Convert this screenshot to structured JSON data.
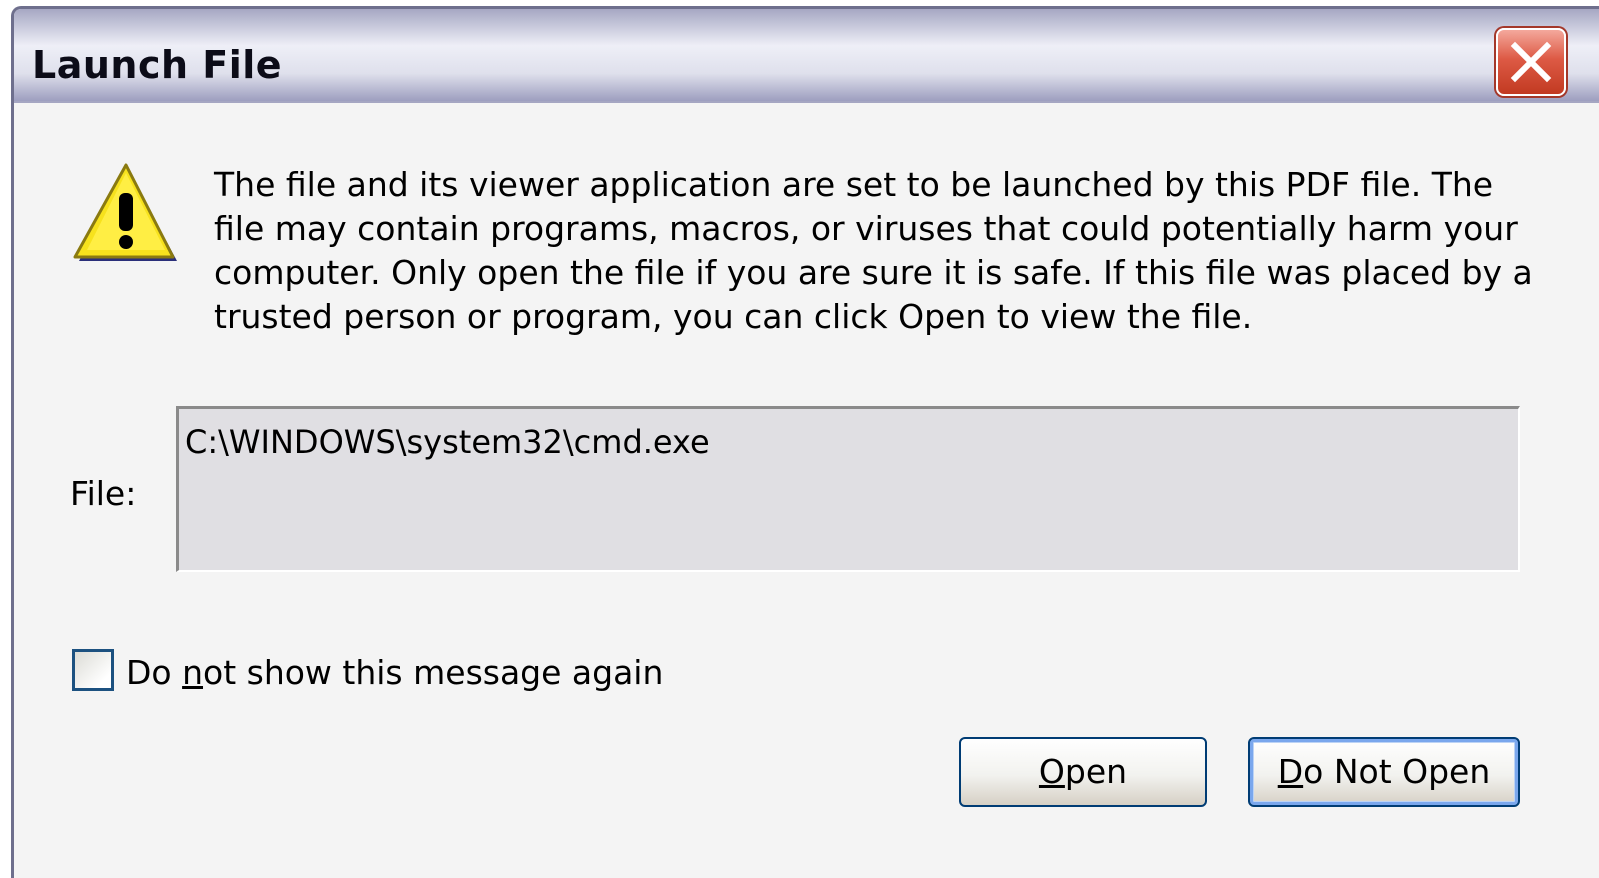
{
  "dialog": {
    "title": "Launch File",
    "message": "The file and its viewer application are set to be launched by this PDF file. The file may contain programs, macros, or viruses that could potentially harm your computer. Only open the file if you are sure it is safe. If this file was placed by a trusted person or program, you can click Open to view the file.",
    "file_label": "File:",
    "file_path": "C:\\WINDOWS\\system32\\cmd.exe",
    "checkbox": {
      "label_before": "Do ",
      "label_accel": "n",
      "label_after": "ot show this message again",
      "checked": false
    },
    "buttons": {
      "open": {
        "accel": "O",
        "rest": "pen"
      },
      "do_not_open": {
        "accel": "D",
        "rest": "o Not Open"
      }
    },
    "icons": {
      "warning": "warning-icon",
      "close": "close-icon"
    }
  }
}
